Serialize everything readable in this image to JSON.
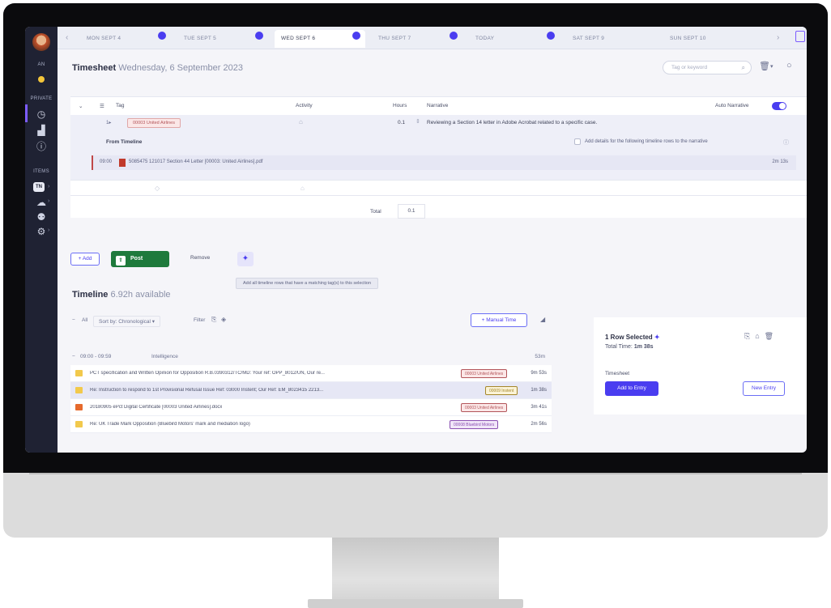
{
  "sidebar": {
    "user_label": "AN",
    "section_private": "PRIVATE",
    "section_items": "ITEMS",
    "badge": "TN"
  },
  "tabs": [
    {
      "label": "MON SEPT 4"
    },
    {
      "label": "TUE SEPT 5"
    },
    {
      "label": "WED SEPT 6"
    },
    {
      "label": "THU SEPT 7"
    },
    {
      "label": "TODAY"
    },
    {
      "label": "SAT SEPT 9"
    },
    {
      "label": "SUN SEPT 10"
    }
  ],
  "header": {
    "title_bold": "Timesheet",
    "title_date": "Wednesday, 6 September 2023",
    "search_placeholder": "Tag or keyword"
  },
  "entry": {
    "col_tag": "Tag",
    "col_activity": "Activity",
    "col_hours": "Hours",
    "col_narrative": "Narrative",
    "auto_narrative": "Auto Narrative",
    "row_tag": "00003 United Airlines",
    "row_hours": "0.1",
    "row_narrative": "Reviewing a Section 14 letter in Adobe Acrobat related to a specific case.",
    "from_timeline": "From Timeline",
    "add_details": "Add details for the following timeline rows to the narrative",
    "timeline_item_time": "09:00",
    "timeline_item": "5085475 121017 Section 44 Letter [00003: United Airlines].pdf",
    "timeline_item_dur": "2m 13s",
    "total_label": "Total",
    "total_value": "0.1"
  },
  "actions": {
    "add": "+ Add",
    "post": "Post",
    "remove": "Remove",
    "tooltip": "Add all timeline rows that have a matching tag(s) to this selection"
  },
  "timeline": {
    "title_bold": "Timeline",
    "available": "6.92h available",
    "all": "All",
    "sort": "Sort by: Chronological",
    "filter": "Filter",
    "manual": "+ Manual Time",
    "group_time": "09:00 - 09:59",
    "group_label": "Intelligence",
    "group_total": "53m",
    "rows": [
      {
        "icon": "#f2c94c",
        "text": "PCT specification and Written Opinion for Opposition R.B.0390312/TC/MD: Your ref: OPP_8012/UN, Our re...",
        "tag": "00003 United Airlines",
        "tag_color": "#b3555a",
        "tag_bg": "#fbe7e7",
        "dur": "9m 53s",
        "selected": false
      },
      {
        "icon": "#f2c94c",
        "text": "Re: Instruction to respond to 1st Provisional Refusal Issue Ref: 03000 Instent; Our Ref: EM_8023415 2213...",
        "tag": "00009 Instent",
        "tag_color": "#a5872a",
        "tag_bg": "#fbf3d6",
        "dur": "1m 38s",
        "selected": true
      },
      {
        "icon": "#e66a2c",
        "text": "20180905 ePct Digital Certificate [00003 United Airlines].docx",
        "tag": "00003 United Airlines",
        "tag_color": "#b3555a",
        "tag_bg": "#fbe7e7",
        "dur": "3m 41s",
        "selected": false
      },
      {
        "icon": "#f2c94c",
        "text": "Re: UK Trade Mark Opposition (Bluebird Motors' mark and mediation logo)",
        "tag": "00008 Bluebird Motors",
        "tag_color": "#8a4fb1",
        "tag_bg": "#f1e6f8",
        "dur": "2m 56s",
        "selected": false
      }
    ]
  },
  "selection": {
    "title": "1 Row Selected",
    "total_label": "Total Time:",
    "total_value": "1m 38s",
    "timesheet_label": "Timesheet",
    "add_to_entry": "Add to Entry",
    "new_entry": "New Entry"
  }
}
